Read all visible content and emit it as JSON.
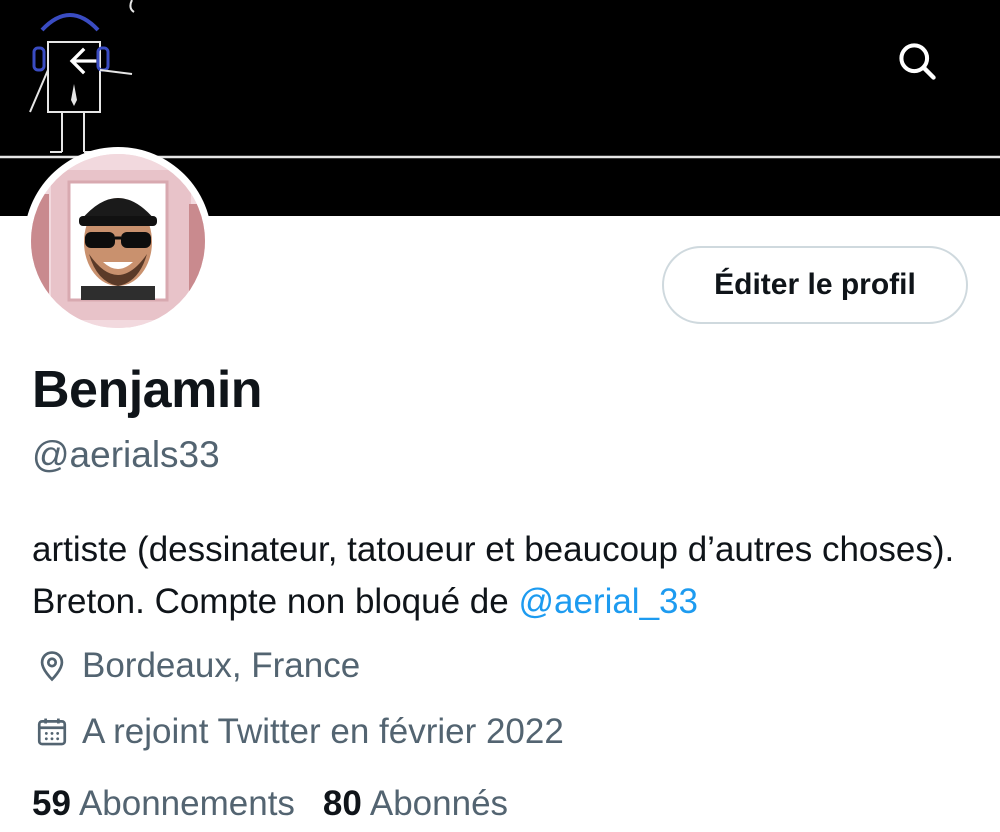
{
  "header": {
    "back_icon": "arrow-left-icon",
    "search_icon": "search-icon"
  },
  "profile": {
    "edit_button_label": "Éditer le profil",
    "display_name": "Benjamin",
    "handle": "@aerials33",
    "bio_text": "artiste (dessinateur, tatoueur et beaucoup d’autres choses). Breton. Compte non bloqué de ",
    "bio_mention": "@aerial_33",
    "location": "Bordeaux, France",
    "joined": "A rejoint Twitter en février 2022",
    "following_count": "59",
    "following_label": "Abonnements",
    "followers_count": "80",
    "followers_label": "Abonnés"
  },
  "colors": {
    "text_primary": "#0f1419",
    "text_secondary": "#536471",
    "link": "#1d9bf0",
    "banner": "#000000",
    "button_border": "#cfd9de"
  }
}
